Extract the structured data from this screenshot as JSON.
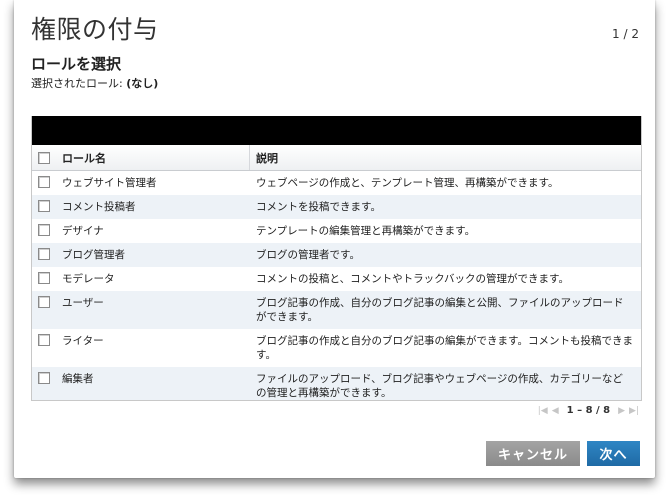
{
  "dialog": {
    "title": "権限の付与",
    "step": "1 / 2",
    "section_title": "ロールを選択",
    "selected_label": "選択されたロール: ",
    "selected_value": "(なし)"
  },
  "table": {
    "columns": {
      "name": "ロール名",
      "description": "説明"
    },
    "rows": [
      {
        "name": "ウェブサイト管理者",
        "description": "ウェブページの作成と、テンプレート管理、再構築ができます。"
      },
      {
        "name": "コメント投稿者",
        "description": "コメントを投稿できます。"
      },
      {
        "name": "デザイナ",
        "description": "テンプレートの編集管理と再構築ができます。"
      },
      {
        "name": "ブログ管理者",
        "description": "ブログの管理者です。"
      },
      {
        "name": "モデレータ",
        "description": "コメントの投稿と、コメントやトラックバックの管理ができます。"
      },
      {
        "name": "ユーザー",
        "description": "ブログ記事の作成、自分のブログ記事の編集と公開、ファイルのアップロードができます。"
      },
      {
        "name": "ライター",
        "description": "ブログ記事の作成と自分のブログ記事の編集ができます。コメントも投稿できます。"
      },
      {
        "name": "編集者",
        "description": "ファイルのアップロード、ブログ記事やウェブページの作成、カテゴリーなどの管理と再構築ができます。"
      }
    ]
  },
  "pager": {
    "range": "1 – 8 / 8",
    "first_icon": "first-page-icon",
    "prev_icon": "prev-page-icon",
    "next_icon": "next-page-icon",
    "last_icon": "last-page-icon"
  },
  "buttons": {
    "cancel": "キャンセル",
    "next": "次へ"
  },
  "colors": {
    "header_bar": "#000000",
    "alt_row": "#edf2f7",
    "next_button": "#2376b4",
    "cancel_button": "#999999"
  }
}
